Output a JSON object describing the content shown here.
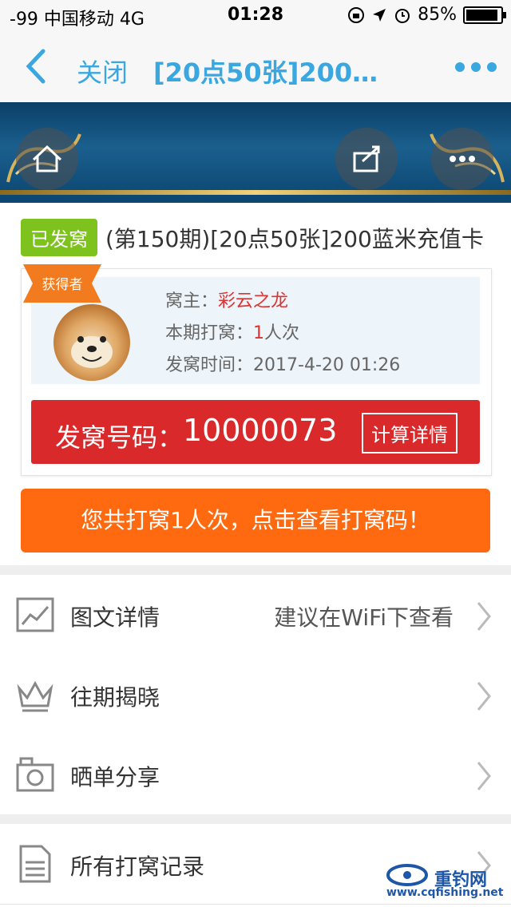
{
  "status_bar": {
    "carrier": "-99 中国移动  4G",
    "time": "01:28",
    "battery": "85%"
  },
  "nav": {
    "close_label": "关闭",
    "title": "[20点50张]200…"
  },
  "product": {
    "status_badge": "已发窝",
    "title": "(第150期)[20点50张]200蓝米充值卡"
  },
  "winner": {
    "ribbon_label": "获得者",
    "owner_label": "窝主：",
    "owner_name": "彩云之龙",
    "times_label": "本期打窝：",
    "times_value": "1",
    "times_unit": "人次",
    "time_label": "发窝时间：",
    "time_value": "2017-4-20 01:26",
    "code_label": "发窝号码：",
    "code_value": "10000073",
    "calc_button": "计算详情"
  },
  "action_button": "您共打窝1人次，点击查看打窝码！",
  "menu": [
    {
      "label": "图文详情",
      "hint": "建议在WiFi下查看",
      "icon": "image-icon"
    },
    {
      "label": "往期揭晓",
      "hint": "",
      "icon": "crown-icon"
    },
    {
      "label": "晒单分享",
      "hint": "",
      "icon": "camera-icon"
    },
    {
      "label": "所有打窝记录",
      "hint": "",
      "icon": "document-icon"
    }
  ],
  "watermark": {
    "name": "重钓网",
    "url": "www.cqfishing.net"
  },
  "colors": {
    "accent_blue": "#3aa7e0",
    "badge_green": "#7ec21e",
    "code_red": "#d9292b",
    "action_orange": "#ff6a10"
  }
}
